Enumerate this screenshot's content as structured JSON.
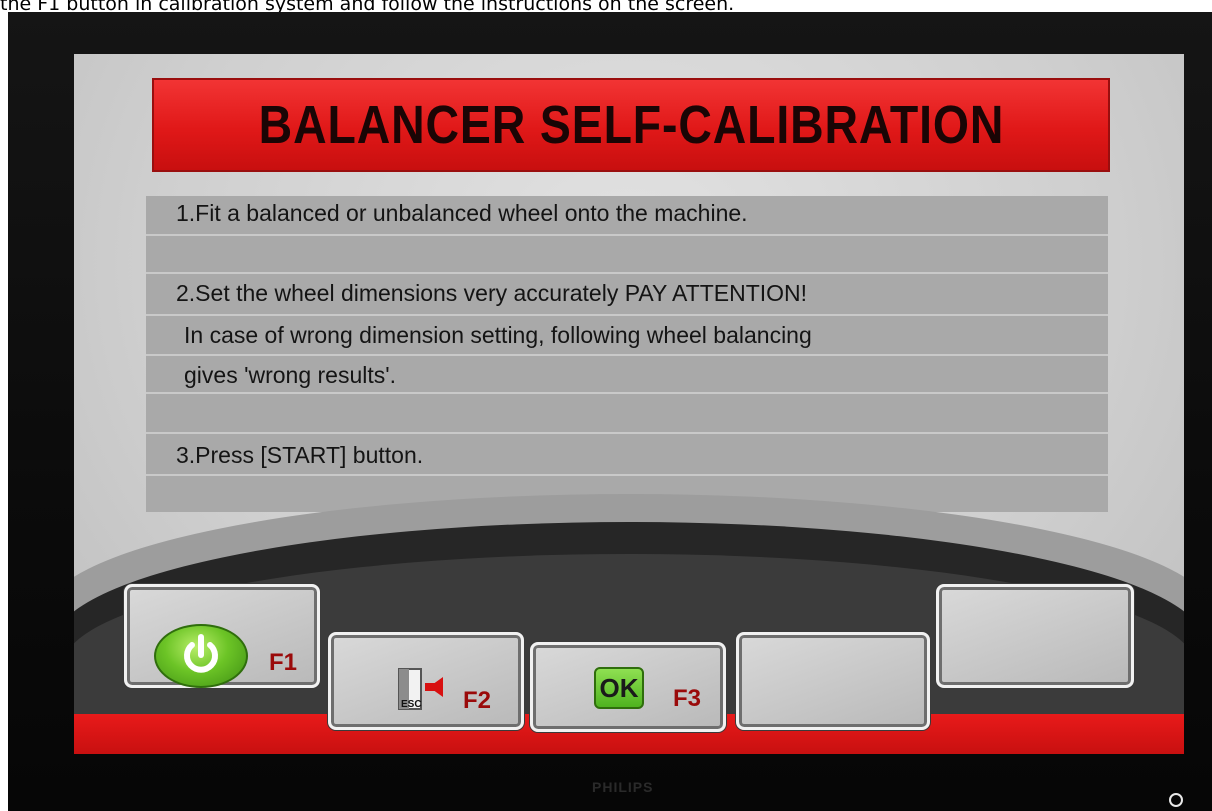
{
  "caption": "the F1 button in calibration system and follow the instructions on the screen.",
  "monitor": {
    "brand": "PHILIPS"
  },
  "screen": {
    "title": "BALANCER SELF-CALIBRATION",
    "instructions": [
      {
        "line1": "1.Fit a balanced or unbalanced wheel onto the machine."
      },
      {
        "line1": "2.Set the wheel dimensions very accurately PAY ATTENTION!",
        "line2": "In case of wrong dimension setting, following wheel balancing",
        "line3": "gives 'wrong results'."
      },
      {
        "line1": "3.Press [START] button."
      }
    ]
  },
  "function_keys": [
    {
      "key": "F1",
      "icon": "power-icon"
    },
    {
      "key": "F2",
      "icon": "esc-exit-icon",
      "icon_text": "ESC"
    },
    {
      "key": "F3",
      "icon": "ok-icon",
      "icon_text": "OK"
    },
    {
      "key": "",
      "icon": ""
    },
    {
      "key": "",
      "icon": ""
    }
  ],
  "colors": {
    "title_red": "#e01818",
    "panel_gray": "#a9a9a9",
    "key_label_red": "#9a0a0a",
    "icon_green": "#6cc426"
  }
}
